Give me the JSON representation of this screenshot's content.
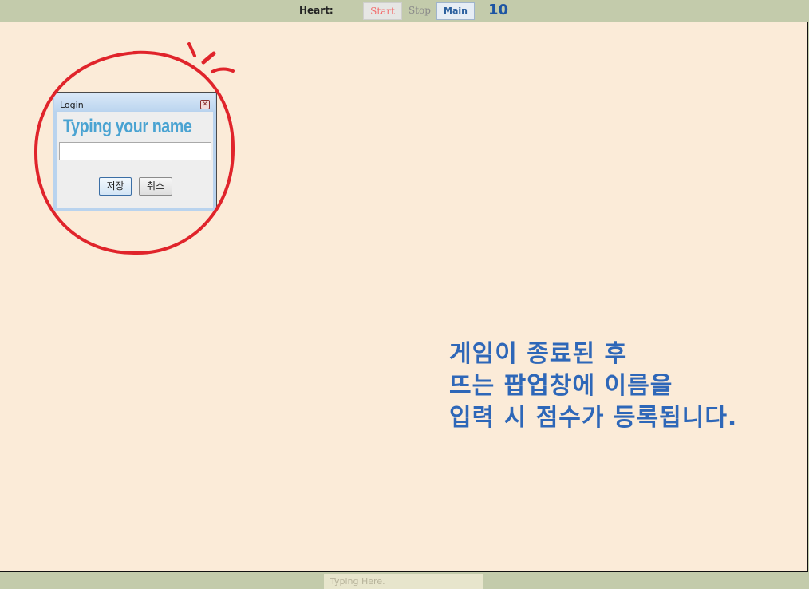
{
  "topbar": {
    "heart_label": "Heart:",
    "start_label": "Start",
    "stop_label": "Stop",
    "main_label": "Main",
    "score": "10"
  },
  "login_dialog": {
    "title": "Login",
    "close_glyph": "✕",
    "heading": "Typing your name",
    "name_value": "",
    "save_label": "저장",
    "cancel_label": "취소"
  },
  "instruction": {
    "line1": "게임이 종료된 후",
    "line2": "뜨는 팝업창에 이름을",
    "line3": "입력 시 점수가 등록됩니다."
  },
  "bottombar": {
    "typing_placeholder": "Typing Here."
  },
  "colors": {
    "bar_background": "#c3cbab",
    "game_background": "#fbebd8",
    "annotation_red": "#e0242b",
    "instruction_blue": "#2e67b8",
    "score_blue": "#1d55a3",
    "heading_blue": "#4aa3d2",
    "start_red": "#f26d6d"
  }
}
